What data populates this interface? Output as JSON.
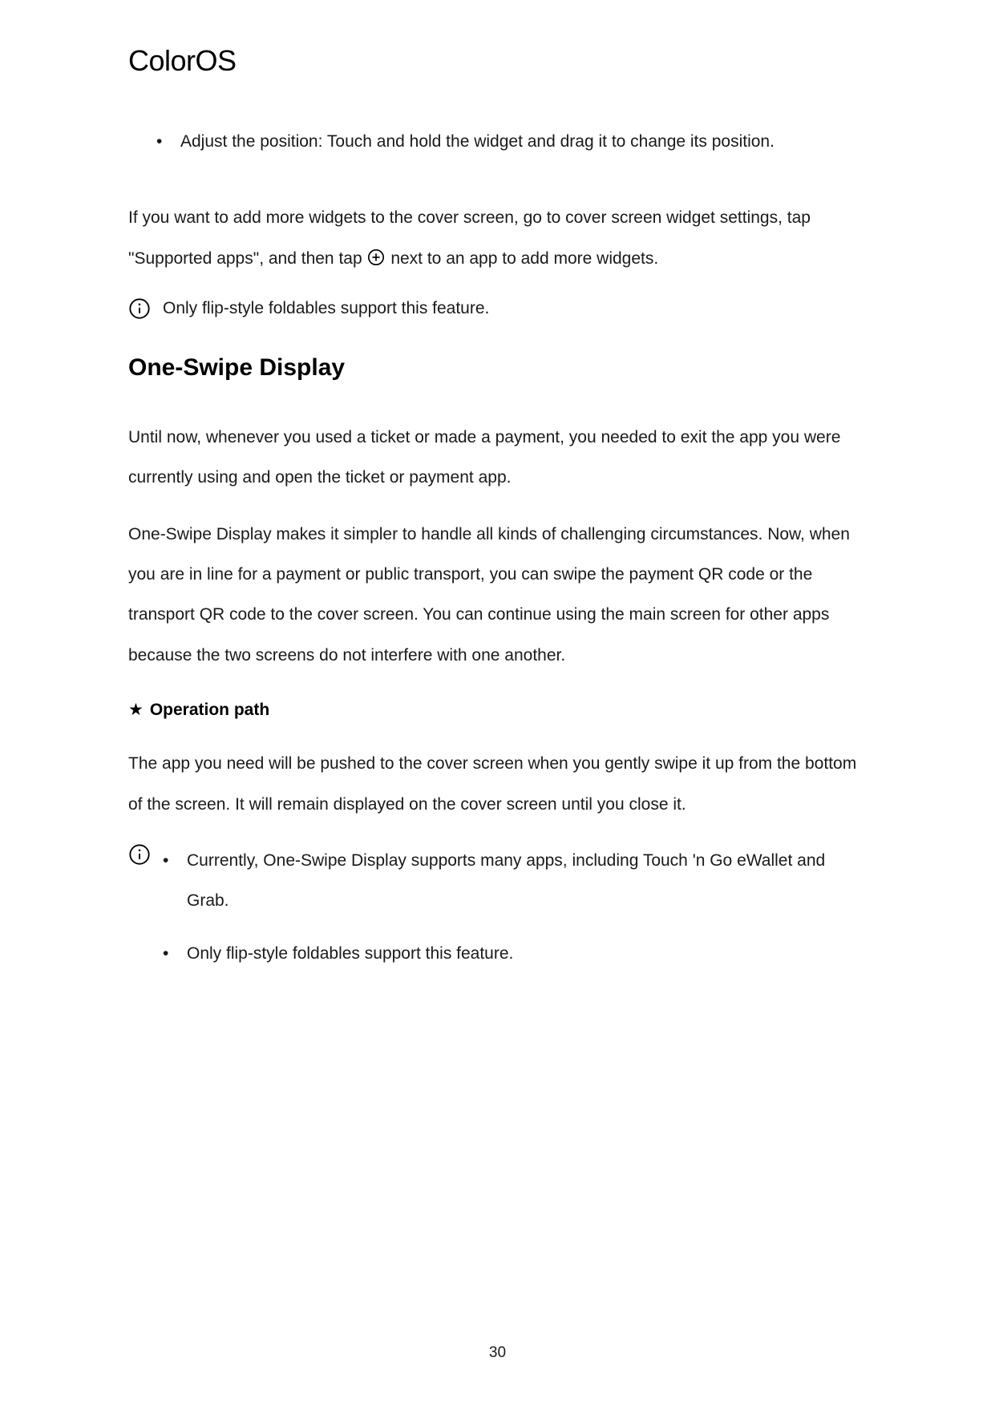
{
  "header": {
    "logo_text": "ColorOS"
  },
  "content": {
    "bullet1": "Adjust the position: Touch and hold the widget and drag it to change its position.",
    "para1_part1": "If you want to add more widgets to the cover screen, go to cover screen widget settings, tap \"Supported apps\", and then tap ",
    "para1_part2": " next to an app to add more widgets.",
    "info1": "Only flip-style foldables support this feature.",
    "heading1": "One-Swipe Display",
    "para2": "Until now, whenever you used a ticket or made a payment, you needed to exit the app you were currently using and open the ticket or payment app.",
    "para3": "One-Swipe Display makes it simpler to handle all kinds of challenging circumstances. Now, when you are in line for a payment or public transport, you can swipe the payment QR code or the transport QR code to the cover screen. You can continue using the main screen for other apps because the two screens do not interfere with one another.",
    "operation_path_label": "Operation path",
    "para4": "The app you need will be pushed to the cover screen when you gently swipe it up from the bottom of the screen. It will remain displayed on the cover screen until you close it.",
    "info_bullet1": "Currently, One-Swipe Display supports many apps, including Touch 'n Go eWallet and Grab.",
    "info_bullet2": "Only flip-style foldables support this feature."
  },
  "footer": {
    "page_number": "30"
  }
}
